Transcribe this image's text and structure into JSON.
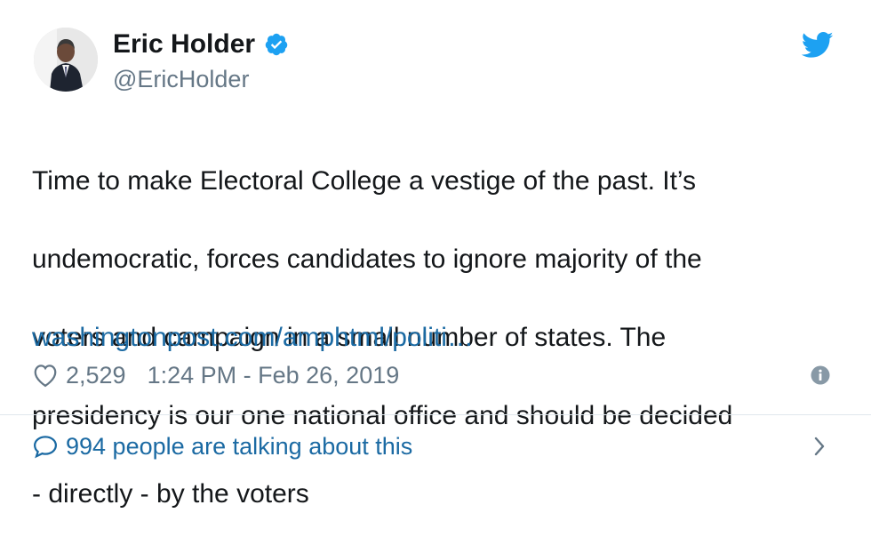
{
  "author": {
    "display_name": "Eric Holder",
    "handle": "@EricHolder",
    "verified": true
  },
  "tweet": {
    "lines": [
      "Time to make Electoral College a vestige of the past. It’s",
      "undemocratic, forces candidates to ignore majority of the",
      "voters and campaign in a small number of states. The",
      "presidency is our one national office and should be decided",
      "- directly - by the voters"
    ],
    "link": "washingtonpost.com/amphtml/politi…"
  },
  "meta": {
    "likes": "2,529",
    "timestamp": "1:24 PM - Feb 26, 2019"
  },
  "footer": {
    "talking_text": "994 people are talking about this"
  },
  "icons": {
    "verified": "verified-badge-icon",
    "bird": "twitter-bird-icon",
    "heart": "heart-icon",
    "info": "info-icon",
    "bubble": "speech-bubble-icon",
    "chevron": "chevron-right-icon"
  },
  "colors": {
    "twitter_blue": "#1da1f2",
    "link_blue": "#1b6aa3",
    "muted_gray": "#657786",
    "text": "#14171a",
    "divider": "#e1e8ed"
  }
}
